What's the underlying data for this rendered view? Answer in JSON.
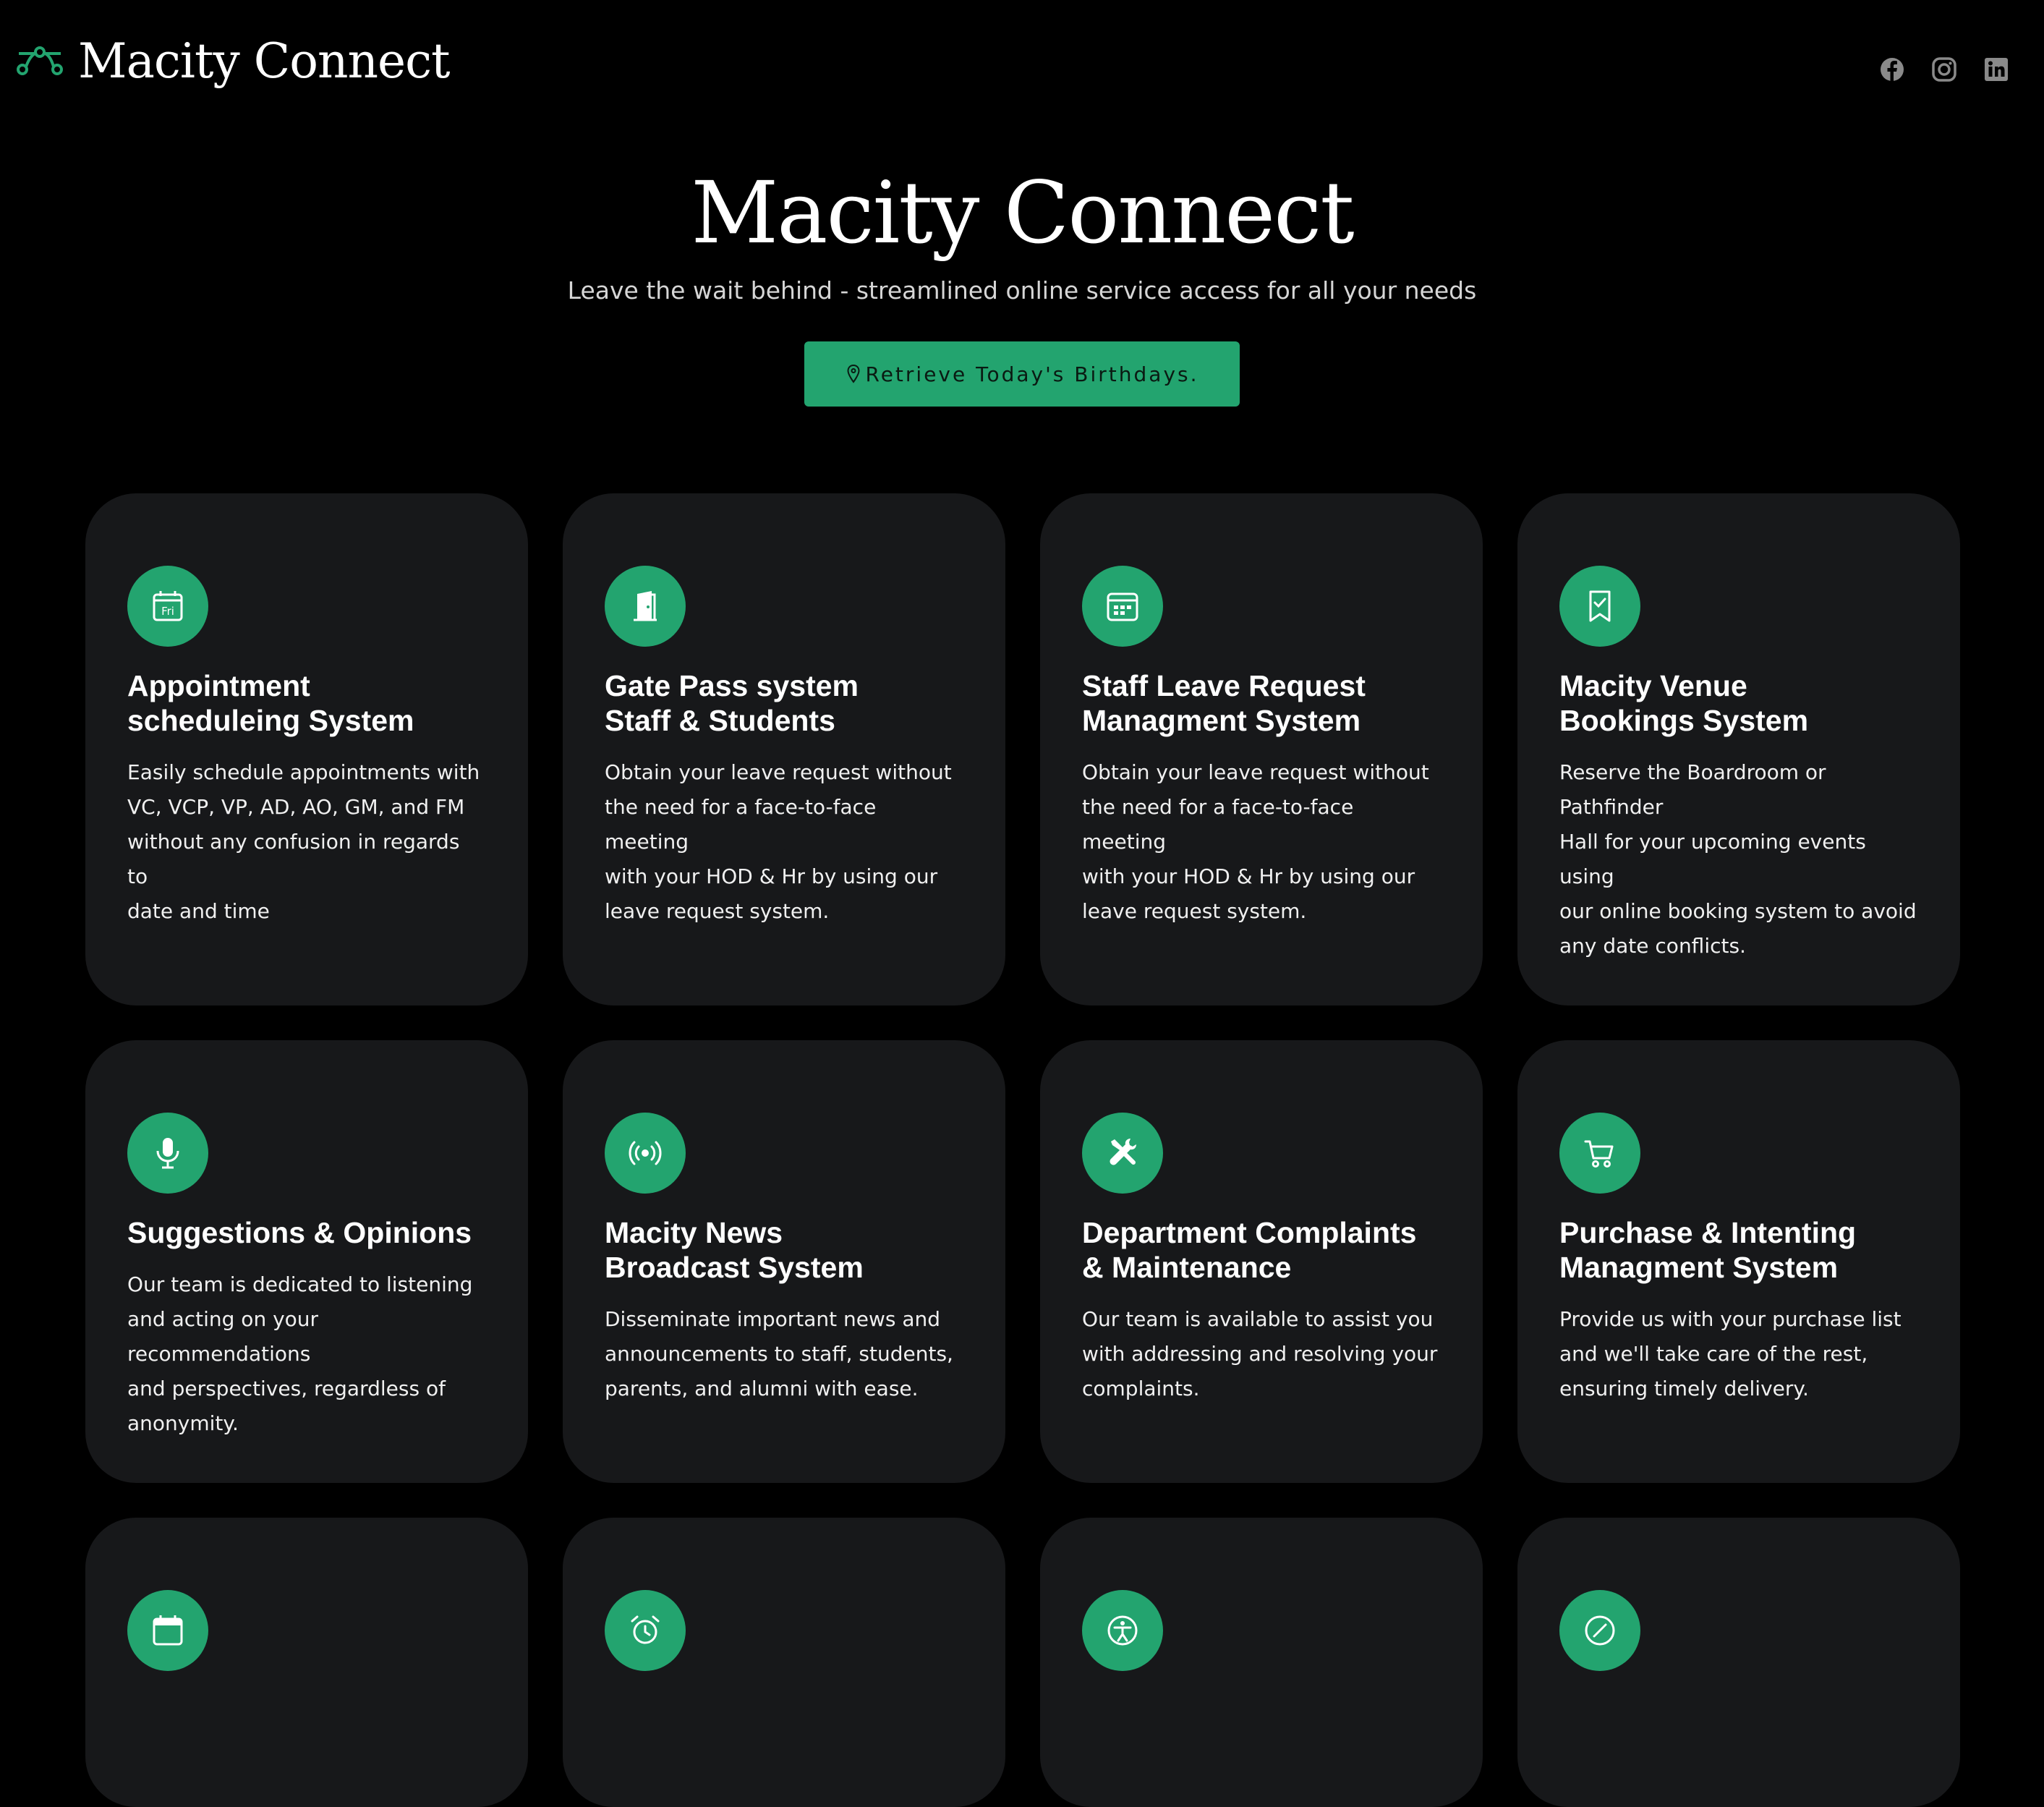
{
  "header": {
    "brand_name": "Macity Connect",
    "brand_logo_icon": "path-nodes-icon",
    "socials": [
      {
        "name": "facebook-icon"
      },
      {
        "name": "instagram-icon"
      },
      {
        "name": "linkedin-icon"
      }
    ]
  },
  "hero": {
    "title": "Macity Connect",
    "subtitle": "Leave the wait behind - streamlined online service access for all your needs",
    "cta_label": "Retrieve Today's Birthdays.",
    "cta_icon": "map-pin-icon"
  },
  "colors": {
    "background": "#000000",
    "card": "#17181a",
    "accent": "#23a46f"
  },
  "cards": [
    {
      "icon": "calendar-fri-icon",
      "title": "Appointment\nscheduleing System",
      "description": "Easily schedule appointments with\nVC, VCP, VP, AD, AO, GM, and FM\nwithout any confusion in regards to\ndate and time"
    },
    {
      "icon": "door-icon",
      "title": "Gate Pass system\nStaff & Students",
      "description": "Obtain your leave request without\nthe need for a face-to-face meeting\nwith your HOD & Hr by using our\nleave request system."
    },
    {
      "icon": "calendar-icon",
      "title": "Staff Leave Request\nManagment System",
      "description": "Obtain your leave request without\nthe need for a face-to-face meeting\nwith your HOD & Hr by using our\nleave request system."
    },
    {
      "icon": "bookmark-check-icon",
      "title": "Macity Venue\nBookings System",
      "description": "Reserve the Boardroom or Pathfinder\nHall for your upcoming events using\nour online booking system to avoid\nany date conflicts."
    },
    {
      "icon": "microphone-icon",
      "title": "Suggestions & Opinions",
      "description": "Our team is dedicated to listening\nand acting on your recommendations\nand perspectives, regardless of\nanonymity."
    },
    {
      "icon": "broadcast-icon",
      "title": "Macity News\nBroadcast System",
      "description": "Disseminate important news and\nannouncements to staff, students,\nparents, and alumni with ease."
    },
    {
      "icon": "tools-icon",
      "title": "Department Complaints\n& Maintenance",
      "description": "Our team is available to assist you\nwith addressing and resolving your\ncomplaints."
    },
    {
      "icon": "shopping-cart-icon",
      "title": "Purchase & Intenting\nManagment System",
      "description": "Provide us with your purchase list\nand we'll take care of the rest,\nensuring timely delivery."
    },
    {
      "icon": "calendar-blank-icon",
      "title": "",
      "description": ""
    },
    {
      "icon": "alarm-clock-icon",
      "title": "",
      "description": ""
    },
    {
      "icon": "accessibility-icon",
      "title": "",
      "description": ""
    },
    {
      "icon": "compass-icon",
      "title": "",
      "description": ""
    }
  ]
}
